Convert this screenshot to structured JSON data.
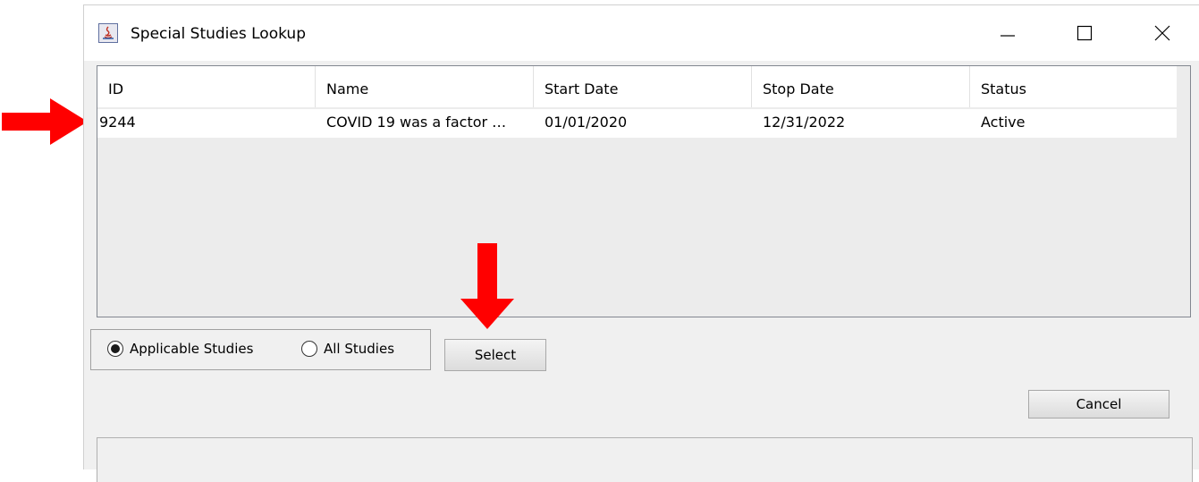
{
  "window": {
    "title": "Special Studies Lookup",
    "controls": {
      "minimize": "minimize-icon",
      "maximize": "maximize-icon",
      "close": "close-icon"
    }
  },
  "table": {
    "columns": [
      "ID",
      "Name",
      "Start Date",
      "Stop Date",
      "Status"
    ],
    "rows": [
      {
        "id": "9244",
        "name": "COVID 19 was a factor …",
        "start_date": "01/01/2020",
        "stop_date": "12/31/2022",
        "status": "Active"
      }
    ]
  },
  "filter": {
    "options": [
      {
        "label": "Applicable Studies",
        "selected": true
      },
      {
        "label": "All Studies",
        "selected": false
      }
    ]
  },
  "buttons": {
    "select": "Select",
    "cancel": "Cancel"
  },
  "annotations": {
    "arrow_color": "#ff0000"
  }
}
